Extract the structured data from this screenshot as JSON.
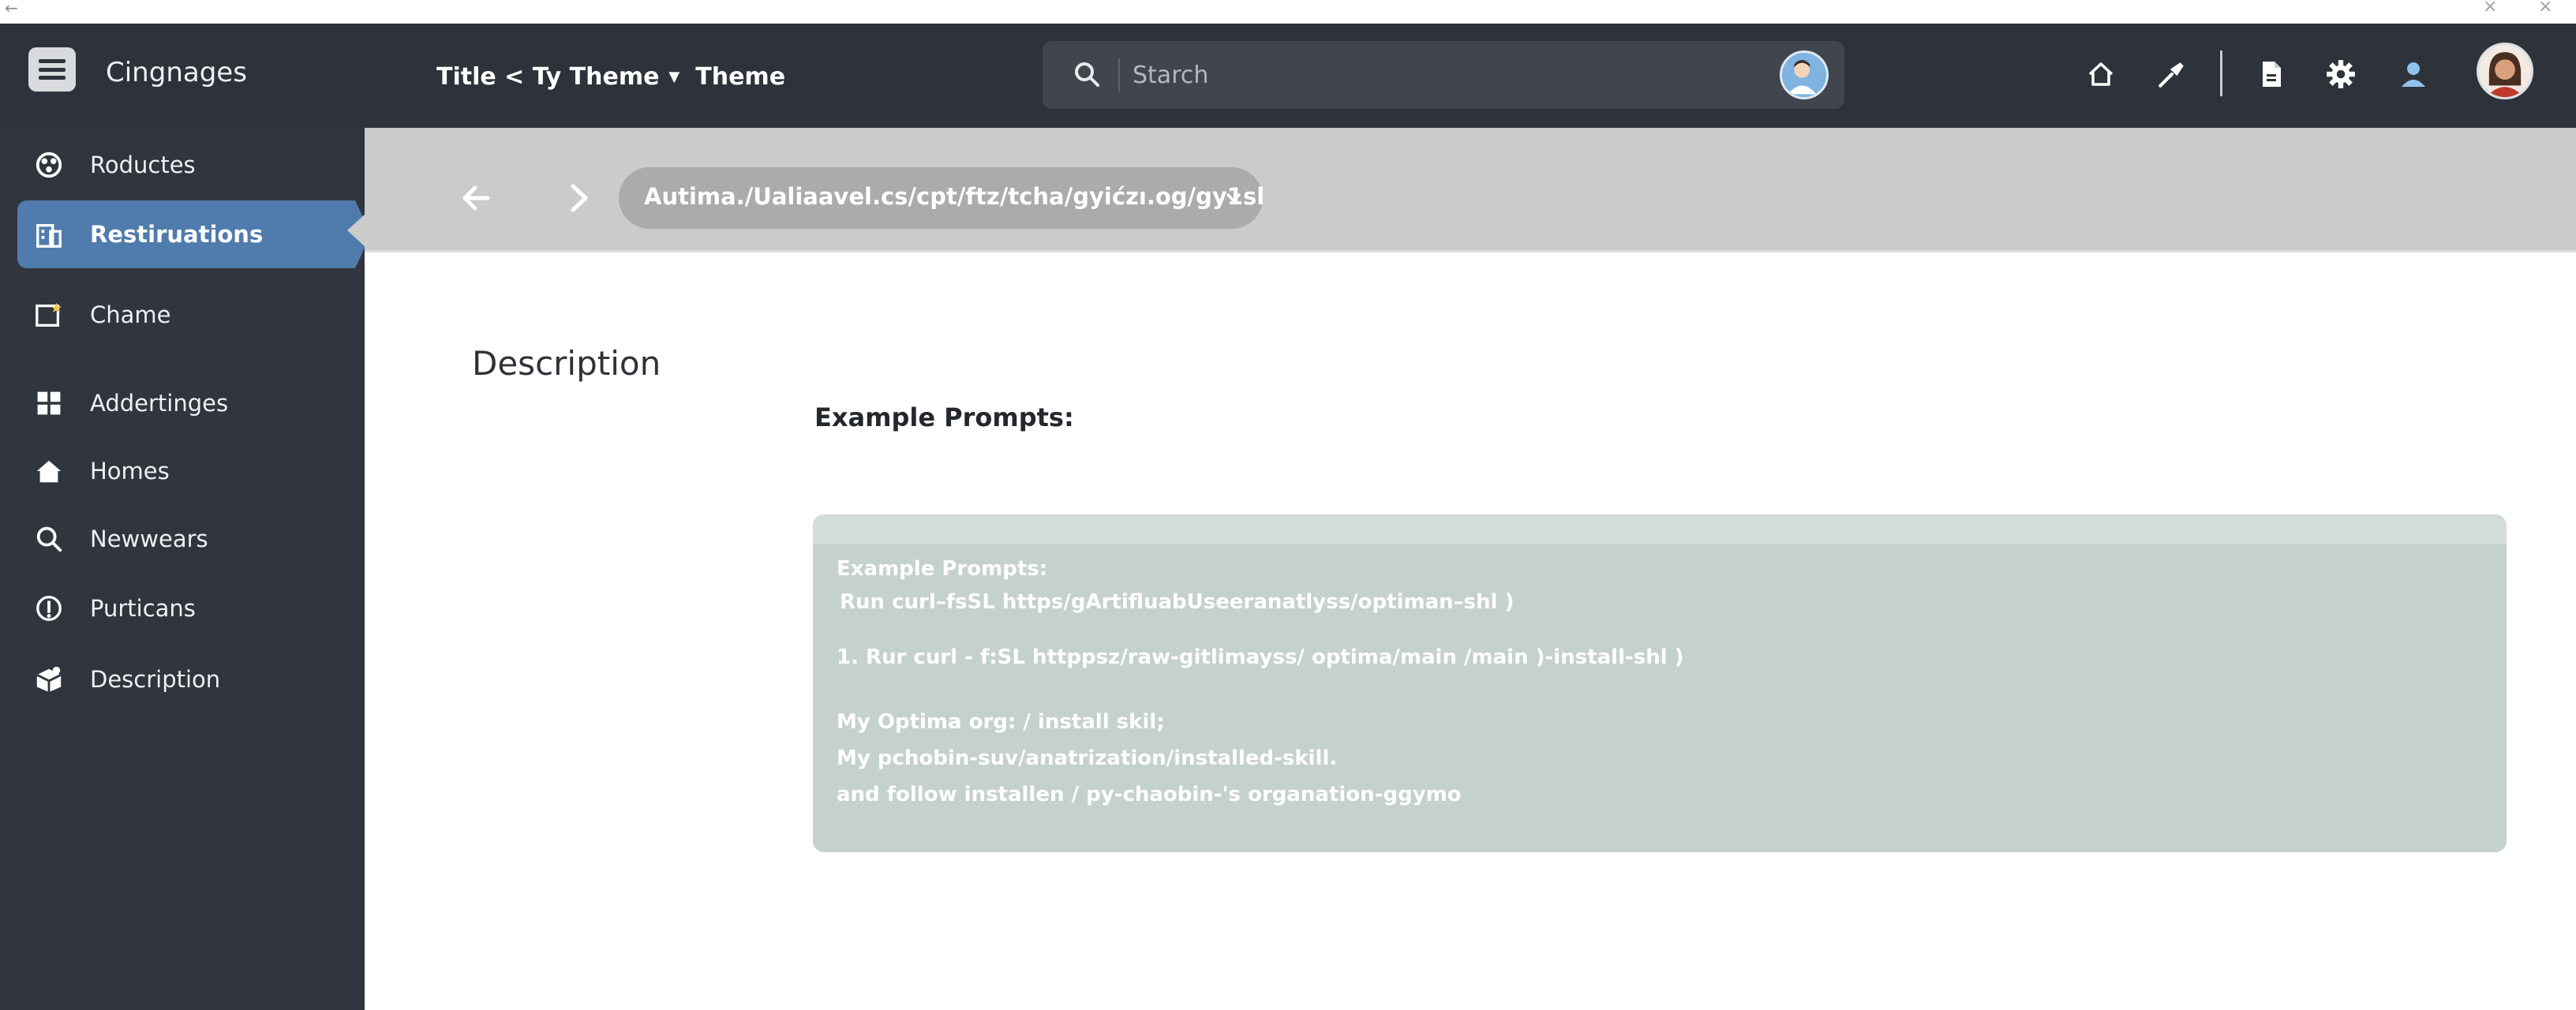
{
  "app": {
    "name": "Cingnages"
  },
  "header": {
    "breadcrumb_main": "Title < Ty Theme",
    "breadcrumb_theme": "Theme",
    "search_placeholder": "Starch"
  },
  "sidebar": {
    "items": [
      {
        "label": "Roductes",
        "icon": "gear-grid-icon"
      },
      {
        "label": "Restiruations",
        "icon": "building-icon",
        "active": true
      },
      {
        "label": "Chame",
        "icon": "star-note-icon"
      },
      {
        "label": "Addertinges",
        "icon": "tiles-icon"
      },
      {
        "label": "Homes",
        "icon": "home-icon"
      },
      {
        "label": "Newwears",
        "icon": "search-icon"
      },
      {
        "label": "Purticans",
        "icon": "info-icon"
      },
      {
        "label": "Description",
        "icon": "package-icon"
      }
    ]
  },
  "address": {
    "url": "Autima./Ualiaavel.cs/cpt/ftz/tcha/gyićzı.og/gy1sl"
  },
  "content": {
    "title": "Description",
    "example_heading": "Example Prompts:",
    "prompt_box": {
      "heading": "Example Prompts:",
      "lines": [
        "Run curl–fsSL https/gArtifluabUseeranatlyss/optiman–shl )",
        "1. Rur curl - f:SL httppsz/raw-gitlimayss/ optima/main /main )-install-shl )",
        "My Optima org: / install skil;",
        "My pchobin-suv/anatrization/installed-skill.",
        "and follow installen / py-chaobin-'s organation-ggymo"
      ]
    }
  },
  "colors": {
    "topbar": "#2e333b",
    "sidebar": "#30353e",
    "active_item": "#4f7bad",
    "nav_strip": "#cbcbcc",
    "prompt_box": "#c5d1cd"
  }
}
